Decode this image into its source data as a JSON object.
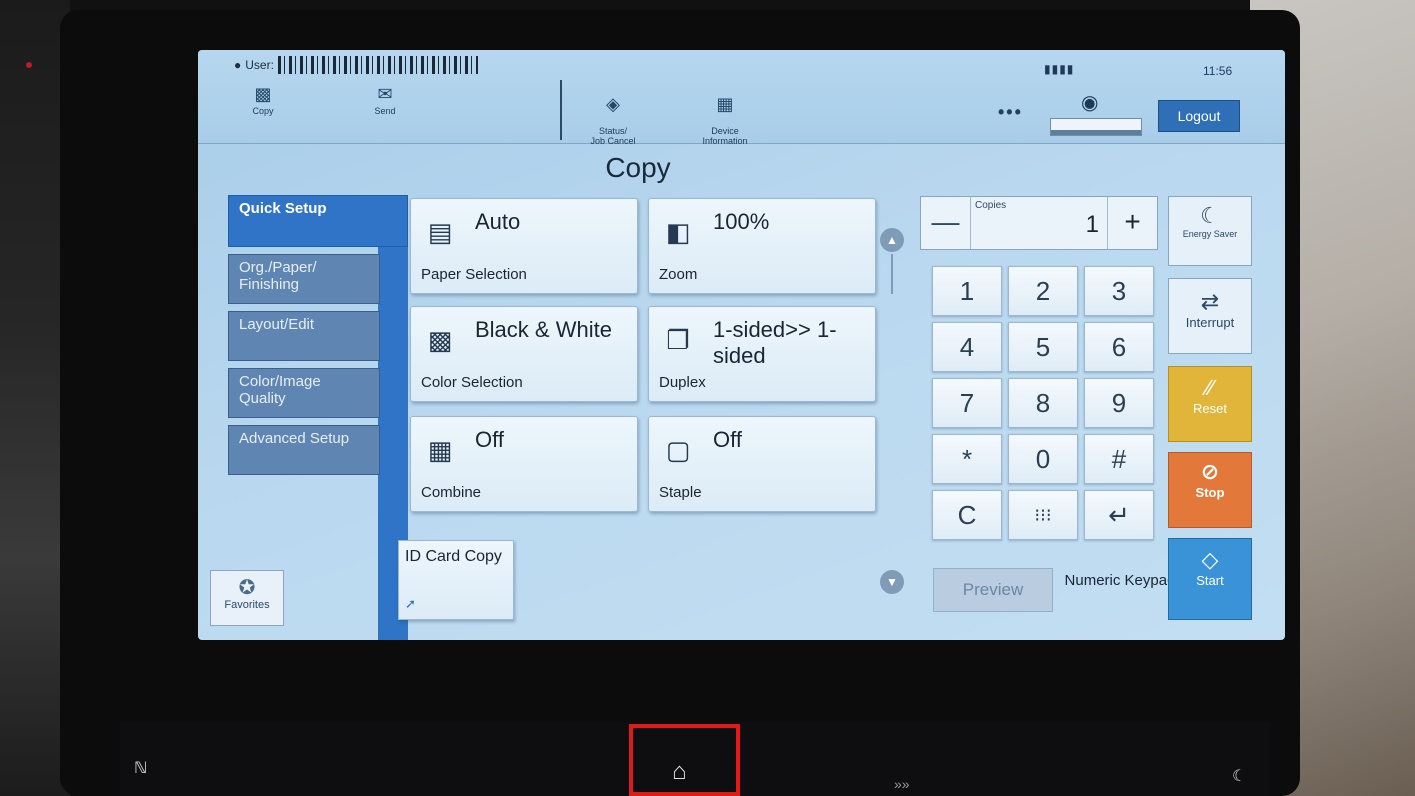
{
  "topbar": {
    "user_label": "User:",
    "copy_label": "Copy",
    "send_label": "Send",
    "status_label": "Status/\nJob Cancel",
    "device_label": "Device\nInformation",
    "time": "11:56",
    "logout_label": "Logout",
    "more_label": "•••"
  },
  "page_title": "Copy",
  "tabs": [
    {
      "label": "Quick Setup"
    },
    {
      "label": "Org./Paper/ Finishing"
    },
    {
      "label": "Layout/Edit"
    },
    {
      "label": "Color/Image Quality"
    },
    {
      "label": "Advanced Setup"
    }
  ],
  "favorites_label": "Favorites",
  "tiles": {
    "paper": {
      "value": "Auto",
      "label": "Paper Selection"
    },
    "zoom": {
      "value": "100%",
      "label": "Zoom"
    },
    "color": {
      "value": "Black & White",
      "label": "Color Selection"
    },
    "duplex": {
      "value": "1-sided>> 1-sided",
      "label": "Duplex"
    },
    "combine": {
      "value": "Off",
      "label": "Combine"
    },
    "staple": {
      "value": "Off",
      "label": "Staple"
    },
    "idcard": {
      "label": "ID Card Copy"
    }
  },
  "copies": {
    "caption": "Copies",
    "value": "1",
    "minus": "—",
    "plus": "+"
  },
  "keypad": {
    "keys": [
      "1",
      "2",
      "3",
      "4",
      "5",
      "6",
      "7",
      "8",
      "9",
      "*",
      "0",
      "#",
      "C",
      "⁝⁝⁝",
      "↵"
    ],
    "preview_label": "Preview",
    "numeric_label": "Numeric Keypad"
  },
  "side": {
    "energy_label": "Energy Saver",
    "interrupt_label": "Interrupt",
    "reset_label": "Reset",
    "stop_label": "Stop",
    "start_label": "Start"
  },
  "colors": {
    "screen_bg": "#b9d8ef",
    "tab_active": "#2f74c6",
    "reset": "#e0b53a",
    "stop": "#e2793a",
    "start": "#3a93d6",
    "highlight_box": "#e01919"
  }
}
